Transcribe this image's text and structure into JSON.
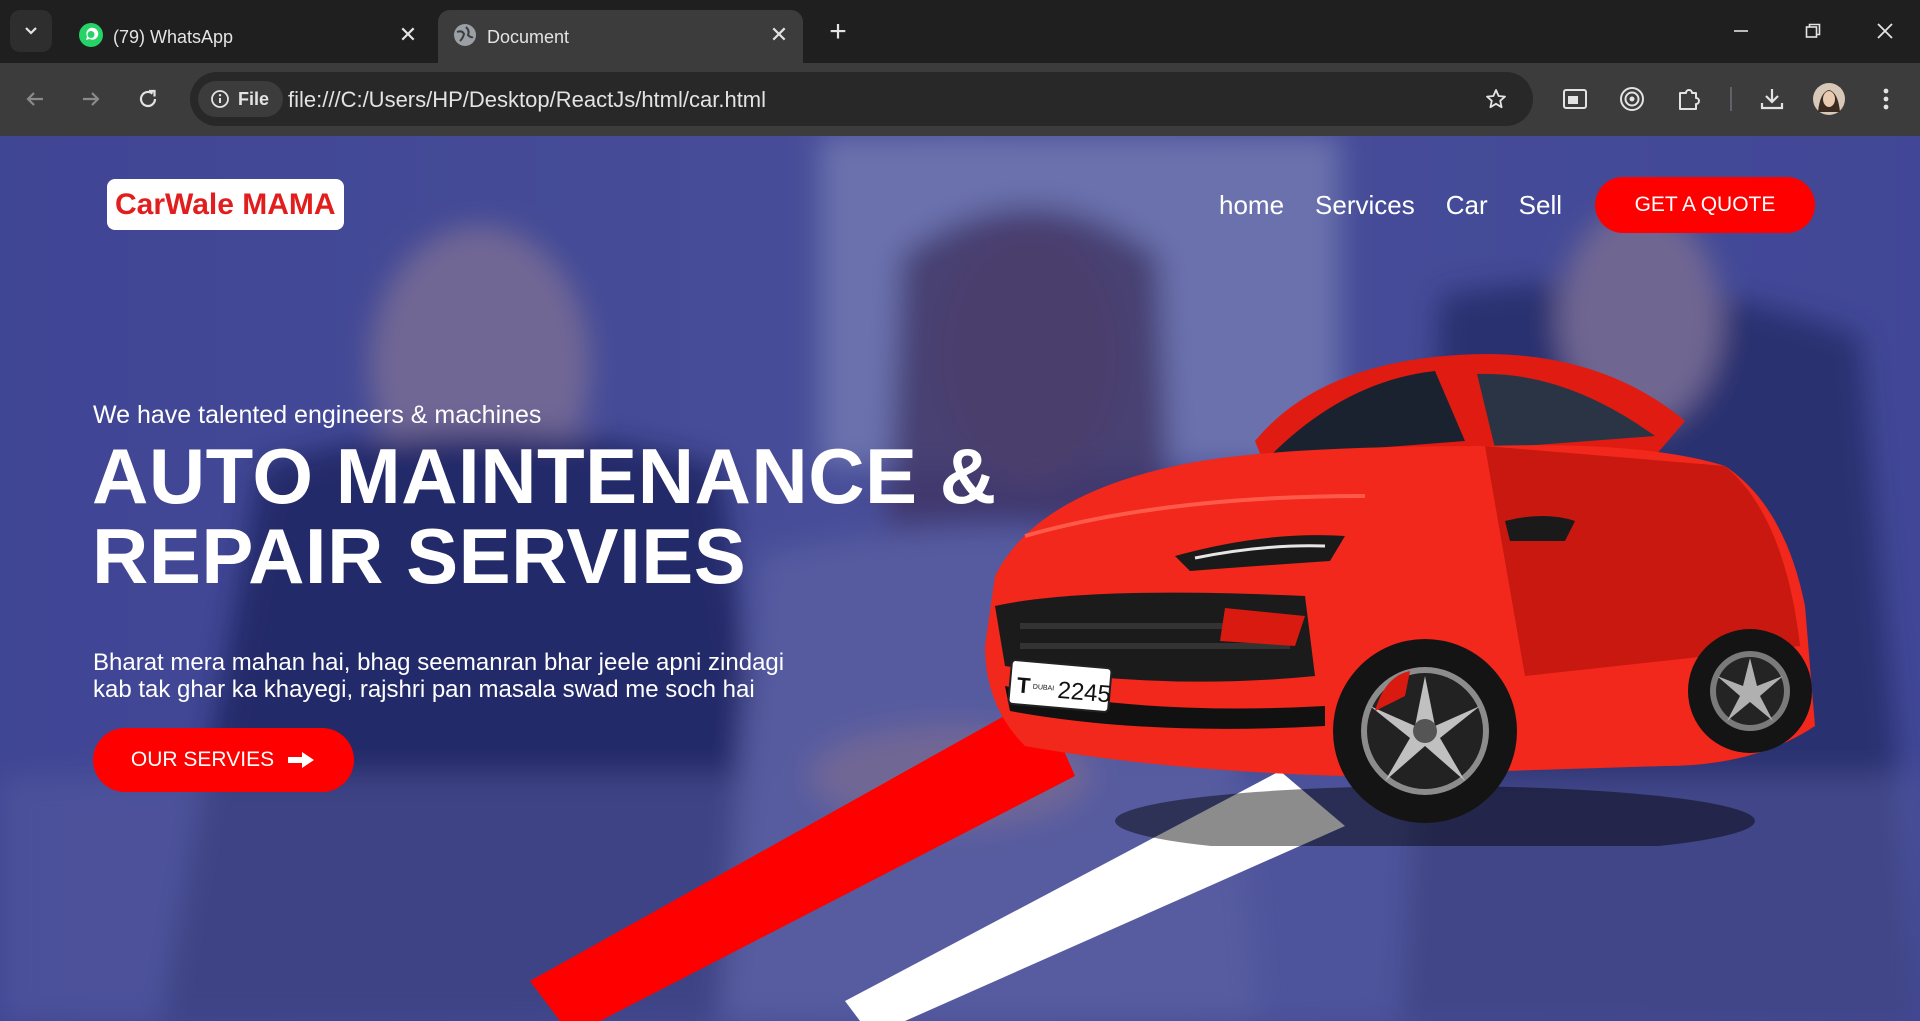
{
  "browser": {
    "tabs": [
      {
        "title": "(79) WhatsApp",
        "favicon": "whatsapp-icon",
        "active": false
      },
      {
        "title": "Document",
        "favicon": "globe-icon",
        "active": true
      }
    ],
    "address": {
      "chip_label": "File",
      "url": "file:///C:/Users/HP/Desktop/ReactJs/html/car.html"
    }
  },
  "page": {
    "logo": "CarWale MAMA",
    "nav": [
      "home",
      "Services",
      "Car",
      "Sell"
    ],
    "cta_quote": "GET A QUOTE",
    "hero": {
      "subtitle": "We have talented engineers & machines",
      "headline_line1": "AUTO MAINTENANCE &",
      "headline_line2": "REPAIR SERVIES",
      "paragraph_line1": "Bharat mera mahan hai, bhag seemanran bhar jeele apni zindagi",
      "paragraph_line2": "kab tak ghar ka khayegi, rajshri pan masala swad me soch hai",
      "button": "OUR SERVIES",
      "plate_letter": "T",
      "plate_number": "2245",
      "plate_city": "DUBAI"
    },
    "colors": {
      "accent": "#ff0000",
      "overlay": "#2a328c",
      "logo_text": "#e21d1d"
    }
  }
}
